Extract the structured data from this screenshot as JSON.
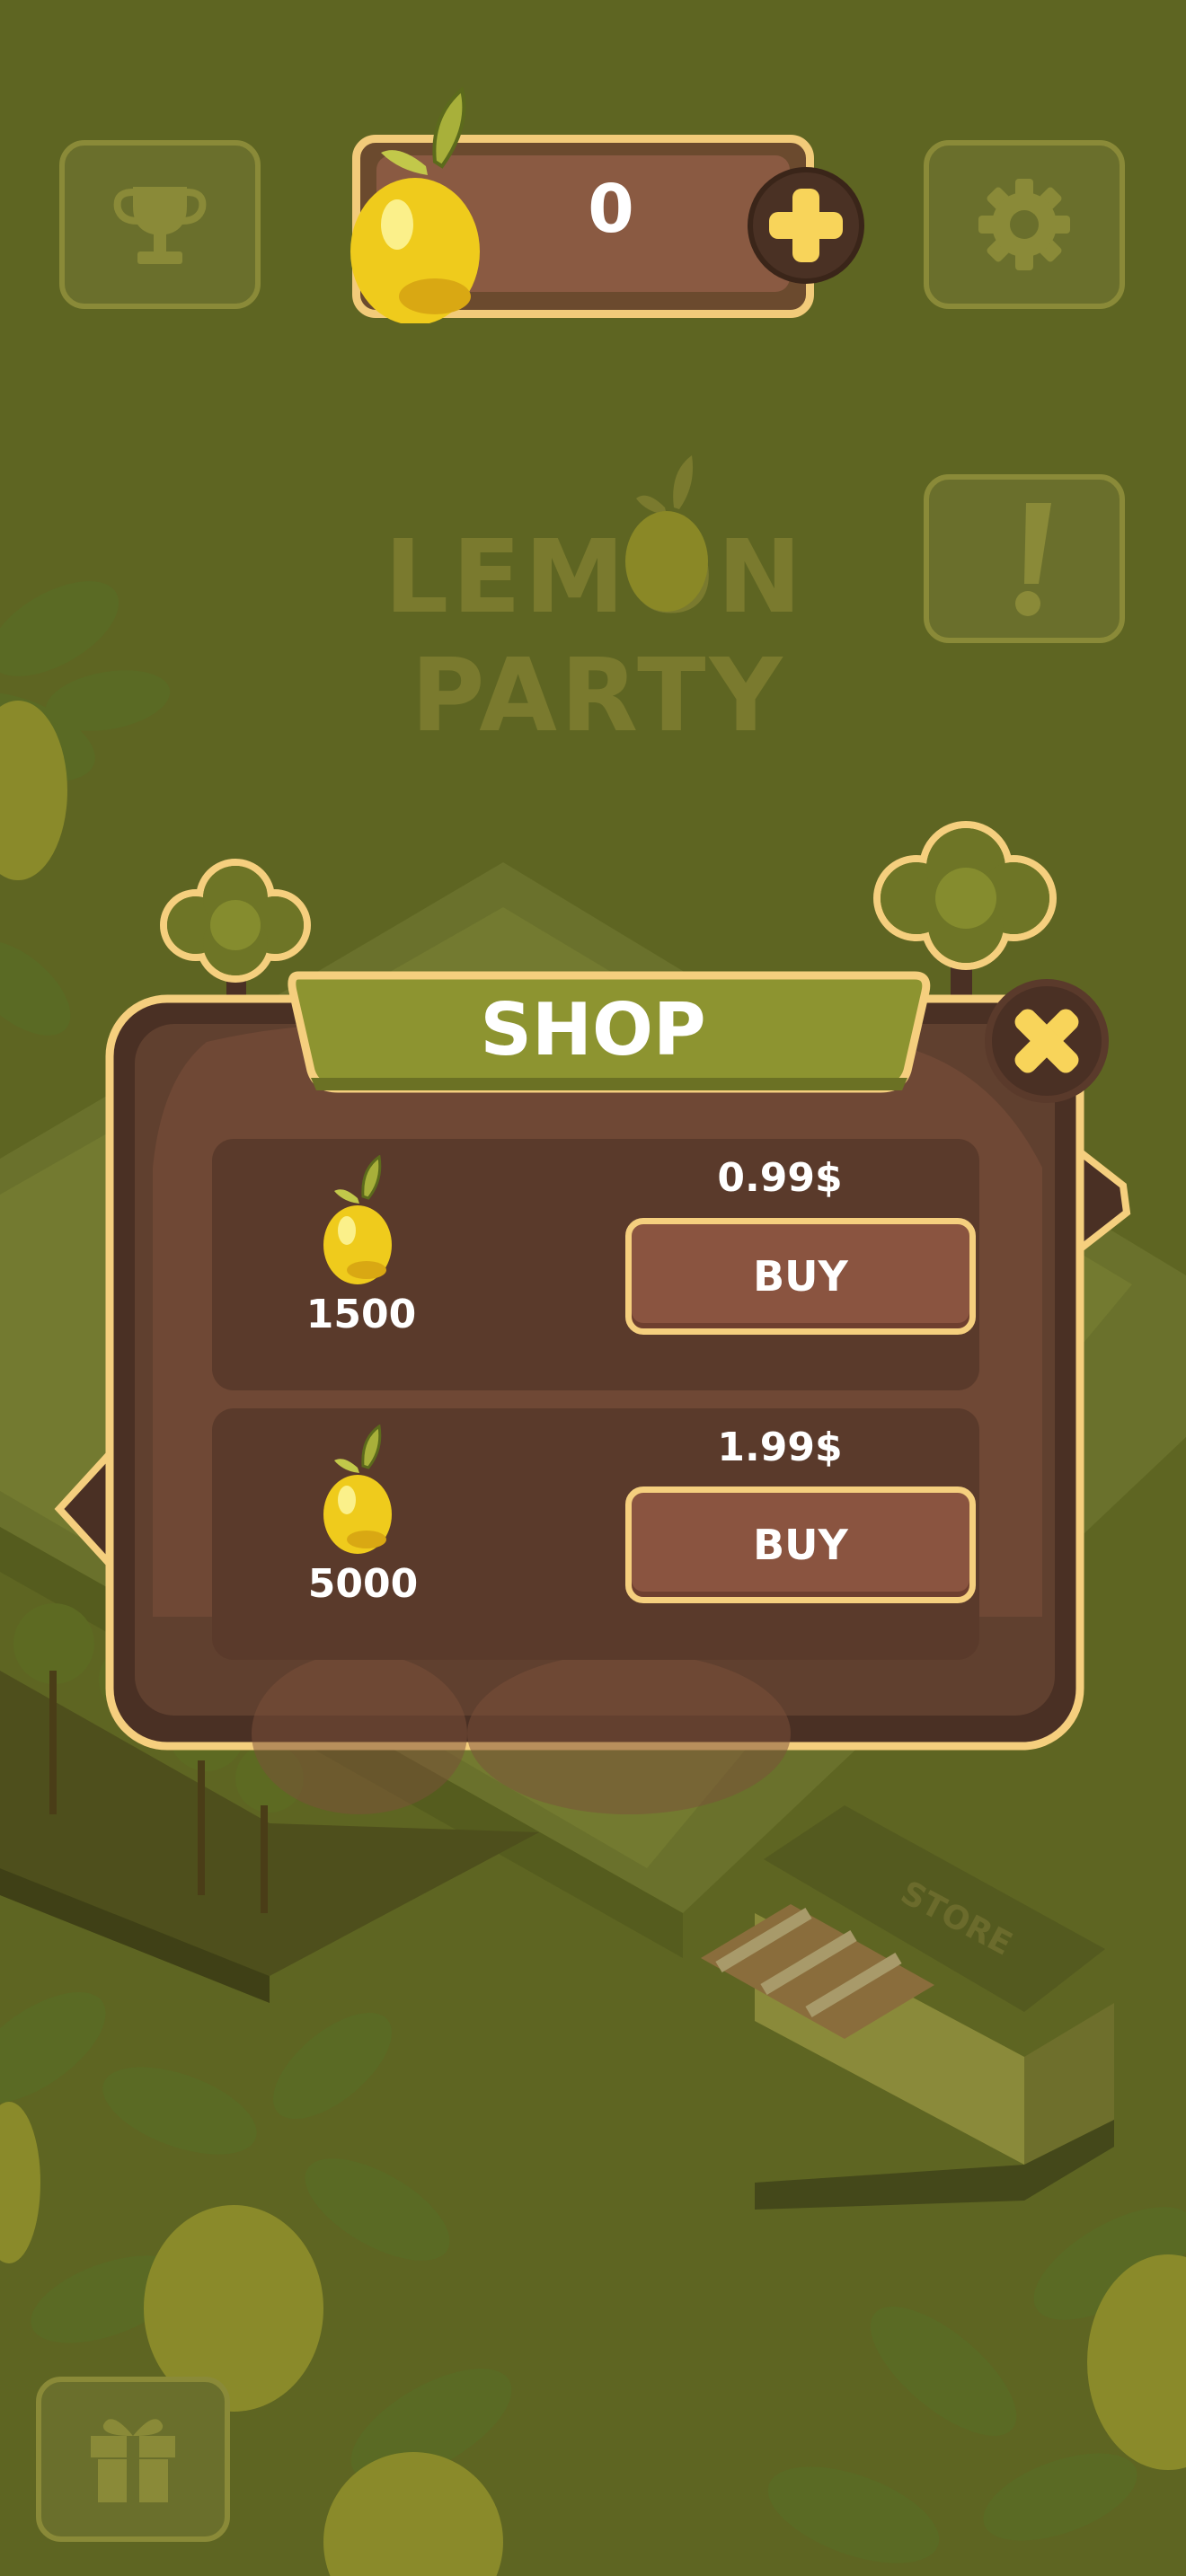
{
  "hud": {
    "lemon_count": "0",
    "trophy_icon": "trophy-icon",
    "settings_icon": "gear-icon",
    "info_icon": "exclamation-icon",
    "gift_icon": "gift-icon",
    "add_icon": "plus-icon"
  },
  "logo": {
    "line1": "LEMON",
    "line2": "PARTY"
  },
  "scene": {
    "store_sign": "STORE"
  },
  "shop": {
    "title": "SHOP",
    "close_icon": "close-icon",
    "items": [
      {
        "amount": "1500",
        "price": "0.99$",
        "buy_label": "BUY",
        "icon": "lemon-icon"
      },
      {
        "amount": "5000",
        "price": "1.99$",
        "buy_label": "BUY",
        "icon": "lemon-icon"
      }
    ]
  },
  "colors": {
    "overlay": "#5e6522",
    "panel_brown": "#60402f",
    "panel_border": "#f5cf7e",
    "header_green": "#8d9430",
    "button_brown": "#8a5440",
    "lemon_yellow": "#f5d423"
  }
}
